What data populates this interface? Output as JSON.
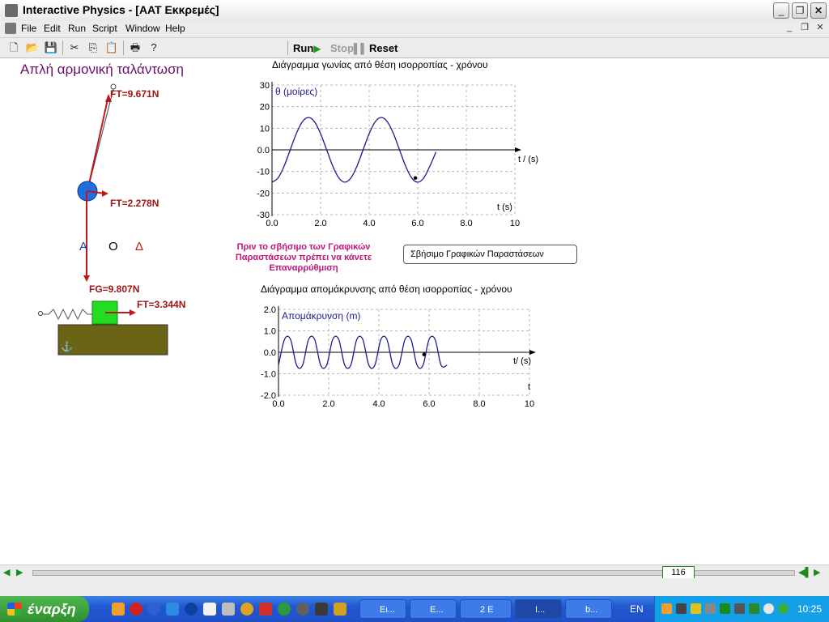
{
  "window": {
    "title": "Interactive Physics - [ΑΑΤ Εκκρεμές]"
  },
  "menu": [
    "File",
    "Edit",
    "Run",
    "Script",
    "Window",
    "Help"
  ],
  "toolbar": {
    "run": "Run",
    "stop": "Stop",
    "reset": "Reset"
  },
  "canvas": {
    "heading": "Απλή αρμονική ταλάντωση",
    "pendulum_labels": {
      "ft_top": "FT=9.671N",
      "ft_mid": "FT=2.278N",
      "fg": "FG=9.807N",
      "ft_block": "FT=3.344N",
      "point_a": "Α",
      "point_o": "Ο",
      "point_delta": "Δ"
    },
    "warning": [
      "Πριν το σβήσιμο των Γραφικών",
      "Παραστάσεων πρέπει να κάνετε",
      "Επαναρρύθμιση"
    ],
    "erase_button": "Σβήσιμο Γραφικών Παραστάσεων"
  },
  "charts": {
    "angle": {
      "title": "Διάγραμμα γωνίας από θέση ισορροπίας - χρόνου",
      "series_label": "θ (μοίρες)",
      "axis_label_right": "t / (s)",
      "axis_label_bottom": "t (s)"
    },
    "displacement": {
      "title": "Διάγραμμα απομάκρυνσης από θέση ισορροπίας - χρόνου",
      "series_label": "Απομάκρυνση (m)",
      "axis_label_right": "t/ (s)",
      "axis_label_bottom": "t"
    }
  },
  "chart_data": [
    {
      "type": "line",
      "title": "Διάγραμμα γωνίας από θέση ισορροπίας - χρόνου",
      "ylabel": "θ (μοίρες)",
      "xlabel": "t / (s)",
      "xlim": [
        0,
        10
      ],
      "ylim": [
        -30,
        30
      ],
      "x_ticks": [
        "0.0",
        "2.0",
        "4.0",
        "6.0",
        "8.0",
        "10"
      ],
      "y_ticks": [
        "30",
        "20",
        "10",
        "0.0",
        "-10",
        "-20",
        "-30"
      ],
      "grid": true,
      "series": [
        {
          "x": [
            0.0,
            0.25,
            0.5,
            0.75,
            1.0,
            1.25,
            1.5,
            1.75,
            2.0,
            2.25,
            2.5,
            2.75,
            3.0,
            3.25,
            3.5,
            3.75,
            4.0,
            4.25,
            4.5,
            4.75,
            5.0,
            5.25,
            5.5,
            5.75,
            6.0,
            6.25,
            6.5,
            6.75
          ],
          "y": [
            -15.0,
            -13.0,
            -7.5,
            0.0,
            7.5,
            13.0,
            15.0,
            13.0,
            7.5,
            0.0,
            -7.5,
            -13.0,
            -15.0,
            -13.0,
            -7.5,
            0.0,
            7.5,
            13.0,
            15.0,
            13.0,
            7.5,
            0.0,
            -7.5,
            -13.0,
            -15.0,
            -13.0,
            -7.5,
            -1.0
          ]
        }
      ],
      "marker_point": {
        "x": 5.9,
        "y": -13
      }
    },
    {
      "type": "line",
      "title": "Διάγραμμα απομάκρυνσης από θέση ισορροπίας - χρόνου",
      "ylabel": "Απομάκρυνση (m)",
      "xlabel": "t/ (s)",
      "xlim": [
        0,
        10
      ],
      "ylim": [
        -2.0,
        2.0
      ],
      "x_ticks": [
        "0.0",
        "2.0",
        "4.0",
        "6.0",
        "8.0",
        "10"
      ],
      "y_ticks": [
        "2.0",
        "1.0",
        "0.0",
        "-1.0",
        "-2.0"
      ],
      "grid": true,
      "series": [
        {
          "x": [
            0.0,
            0.24,
            0.48,
            0.72,
            0.96,
            1.2,
            1.44,
            1.68,
            1.92,
            2.16,
            2.4,
            2.64,
            2.88,
            3.12,
            3.36,
            3.6,
            3.84,
            4.08,
            4.32,
            4.56,
            4.8,
            5.04,
            5.28,
            5.52,
            5.76,
            6.0,
            6.24,
            6.48,
            6.72
          ],
          "y": [
            -0.6,
            0.6,
            0.6,
            -0.6,
            -0.6,
            0.6,
            0.6,
            -0.6,
            -0.6,
            0.6,
            0.6,
            -0.6,
            -0.6,
            0.6,
            0.6,
            -0.6,
            -0.6,
            0.6,
            0.6,
            -0.6,
            -0.6,
            0.6,
            0.6,
            -0.6,
            -0.6,
            0.6,
            0.6,
            -0.6,
            -0.6
          ]
        }
      ],
      "marker_point": {
        "x": 5.8,
        "y": -0.1
      }
    }
  ],
  "scroll": {
    "frame": "116"
  },
  "taskbar": {
    "start": "έναρξη",
    "tasks": [
      "Ει...",
      "Ε...",
      "2 Ε",
      "Ι...",
      "b..."
    ],
    "lang": "EN",
    "time": "10:25"
  },
  "colors": {
    "curve": "#1a1a8c",
    "force": "#c01818",
    "block": "#22dd22",
    "table": "#6b6415",
    "ball": "#1f6fe0"
  }
}
